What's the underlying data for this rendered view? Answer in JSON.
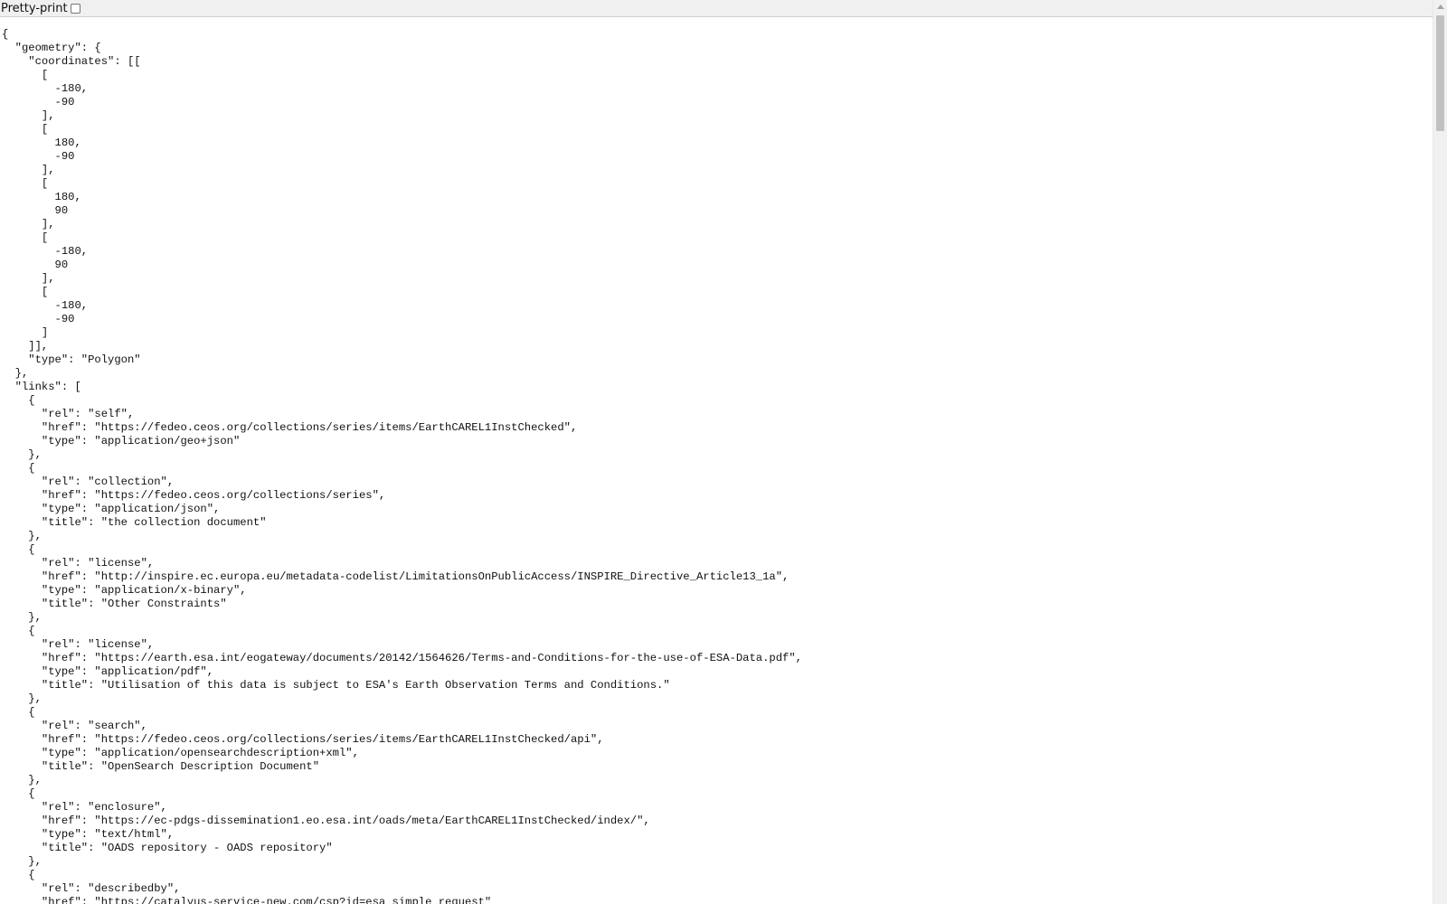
{
  "toolbar": {
    "pretty_print_label": "Pretty-print",
    "pretty_print_checked": false
  },
  "json_lines": [
    "{",
    "  \"geometry\": {",
    "    \"coordinates\": [[",
    "      [",
    "        -180,",
    "        -90",
    "      ],",
    "      [",
    "        180,",
    "        -90",
    "      ],",
    "      [",
    "        180,",
    "        90",
    "      ],",
    "      [",
    "        -180,",
    "        90",
    "      ],",
    "      [",
    "        -180,",
    "        -90",
    "      ]",
    "    ]],",
    "    \"type\": \"Polygon\"",
    "  },",
    "  \"links\": [",
    "    {",
    "      \"rel\": \"self\",",
    "      \"href\": \"https://fedeo.ceos.org/collections/series/items/EarthCAREL1InstChecked\",",
    "      \"type\": \"application/geo+json\"",
    "    },",
    "    {",
    "      \"rel\": \"collection\",",
    "      \"href\": \"https://fedeo.ceos.org/collections/series\",",
    "      \"type\": \"application/json\",",
    "      \"title\": \"the collection document\"",
    "    },",
    "    {",
    "      \"rel\": \"license\",",
    "      \"href\": \"http://inspire.ec.europa.eu/metadata-codelist/LimitationsOnPublicAccess/INSPIRE_Directive_Article13_1a\",",
    "      \"type\": \"application/x-binary\",",
    "      \"title\": \"Other Constraints\"",
    "    },",
    "    {",
    "      \"rel\": \"license\",",
    "      \"href\": \"https://earth.esa.int/eogateway/documents/20142/1564626/Terms-and-Conditions-for-the-use-of-ESA-Data.pdf\",",
    "      \"type\": \"application/pdf\",",
    "      \"title\": \"Utilisation of this data is subject to ESA's Earth Observation Terms and Conditions.\"",
    "    },",
    "    {",
    "      \"rel\": \"search\",",
    "      \"href\": \"https://fedeo.ceos.org/collections/series/items/EarthCAREL1InstChecked/api\",",
    "      \"type\": \"application/opensearchdescription+xml\",",
    "      \"title\": \"OpenSearch Description Document\"",
    "    },",
    "    {",
    "      \"rel\": \"enclosure\",",
    "      \"href\": \"https://ec-pdgs-dissemination1.eo.esa.int/oads/meta/EarthCAREL1InstChecked/index/\",",
    "      \"type\": \"text/html\",",
    "      \"title\": \"OADS repository - OADS repository\"",
    "    },",
    "    {",
    "      \"rel\": \"describedby\",",
    "      \"href\": \"https://catalyus-service-new.com/csp?id=esa_simple_request\""
  ]
}
